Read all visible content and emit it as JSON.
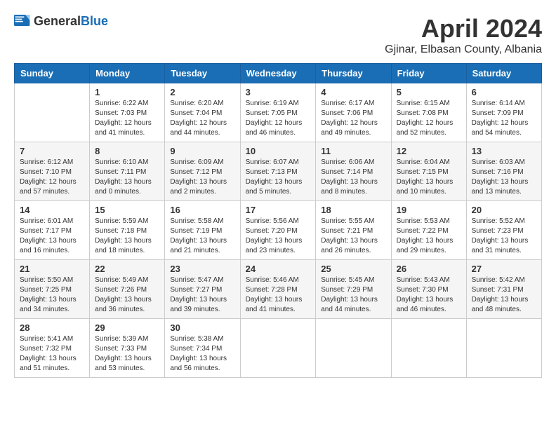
{
  "header": {
    "logo_general": "General",
    "logo_blue": "Blue",
    "month": "April 2024",
    "location": "Gjinar, Elbasan County, Albania"
  },
  "weekdays": [
    "Sunday",
    "Monday",
    "Tuesday",
    "Wednesday",
    "Thursday",
    "Friday",
    "Saturday"
  ],
  "weeks": [
    [
      {
        "day": "",
        "info": ""
      },
      {
        "day": "1",
        "info": "Sunrise: 6:22 AM\nSunset: 7:03 PM\nDaylight: 12 hours\nand 41 minutes."
      },
      {
        "day": "2",
        "info": "Sunrise: 6:20 AM\nSunset: 7:04 PM\nDaylight: 12 hours\nand 44 minutes."
      },
      {
        "day": "3",
        "info": "Sunrise: 6:19 AM\nSunset: 7:05 PM\nDaylight: 12 hours\nand 46 minutes."
      },
      {
        "day": "4",
        "info": "Sunrise: 6:17 AM\nSunset: 7:06 PM\nDaylight: 12 hours\nand 49 minutes."
      },
      {
        "day": "5",
        "info": "Sunrise: 6:15 AM\nSunset: 7:08 PM\nDaylight: 12 hours\nand 52 minutes."
      },
      {
        "day": "6",
        "info": "Sunrise: 6:14 AM\nSunset: 7:09 PM\nDaylight: 12 hours\nand 54 minutes."
      }
    ],
    [
      {
        "day": "7",
        "info": "Sunrise: 6:12 AM\nSunset: 7:10 PM\nDaylight: 12 hours\nand 57 minutes."
      },
      {
        "day": "8",
        "info": "Sunrise: 6:10 AM\nSunset: 7:11 PM\nDaylight: 13 hours\nand 0 minutes."
      },
      {
        "day": "9",
        "info": "Sunrise: 6:09 AM\nSunset: 7:12 PM\nDaylight: 13 hours\nand 2 minutes."
      },
      {
        "day": "10",
        "info": "Sunrise: 6:07 AM\nSunset: 7:13 PM\nDaylight: 13 hours\nand 5 minutes."
      },
      {
        "day": "11",
        "info": "Sunrise: 6:06 AM\nSunset: 7:14 PM\nDaylight: 13 hours\nand 8 minutes."
      },
      {
        "day": "12",
        "info": "Sunrise: 6:04 AM\nSunset: 7:15 PM\nDaylight: 13 hours\nand 10 minutes."
      },
      {
        "day": "13",
        "info": "Sunrise: 6:03 AM\nSunset: 7:16 PM\nDaylight: 13 hours\nand 13 minutes."
      }
    ],
    [
      {
        "day": "14",
        "info": "Sunrise: 6:01 AM\nSunset: 7:17 PM\nDaylight: 13 hours\nand 16 minutes."
      },
      {
        "day": "15",
        "info": "Sunrise: 5:59 AM\nSunset: 7:18 PM\nDaylight: 13 hours\nand 18 minutes."
      },
      {
        "day": "16",
        "info": "Sunrise: 5:58 AM\nSunset: 7:19 PM\nDaylight: 13 hours\nand 21 minutes."
      },
      {
        "day": "17",
        "info": "Sunrise: 5:56 AM\nSunset: 7:20 PM\nDaylight: 13 hours\nand 23 minutes."
      },
      {
        "day": "18",
        "info": "Sunrise: 5:55 AM\nSunset: 7:21 PM\nDaylight: 13 hours\nand 26 minutes."
      },
      {
        "day": "19",
        "info": "Sunrise: 5:53 AM\nSunset: 7:22 PM\nDaylight: 13 hours\nand 29 minutes."
      },
      {
        "day": "20",
        "info": "Sunrise: 5:52 AM\nSunset: 7:23 PM\nDaylight: 13 hours\nand 31 minutes."
      }
    ],
    [
      {
        "day": "21",
        "info": "Sunrise: 5:50 AM\nSunset: 7:25 PM\nDaylight: 13 hours\nand 34 minutes."
      },
      {
        "day": "22",
        "info": "Sunrise: 5:49 AM\nSunset: 7:26 PM\nDaylight: 13 hours\nand 36 minutes."
      },
      {
        "day": "23",
        "info": "Sunrise: 5:47 AM\nSunset: 7:27 PM\nDaylight: 13 hours\nand 39 minutes."
      },
      {
        "day": "24",
        "info": "Sunrise: 5:46 AM\nSunset: 7:28 PM\nDaylight: 13 hours\nand 41 minutes."
      },
      {
        "day": "25",
        "info": "Sunrise: 5:45 AM\nSunset: 7:29 PM\nDaylight: 13 hours\nand 44 minutes."
      },
      {
        "day": "26",
        "info": "Sunrise: 5:43 AM\nSunset: 7:30 PM\nDaylight: 13 hours\nand 46 minutes."
      },
      {
        "day": "27",
        "info": "Sunrise: 5:42 AM\nSunset: 7:31 PM\nDaylight: 13 hours\nand 48 minutes."
      }
    ],
    [
      {
        "day": "28",
        "info": "Sunrise: 5:41 AM\nSunset: 7:32 PM\nDaylight: 13 hours\nand 51 minutes."
      },
      {
        "day": "29",
        "info": "Sunrise: 5:39 AM\nSunset: 7:33 PM\nDaylight: 13 hours\nand 53 minutes."
      },
      {
        "day": "30",
        "info": "Sunrise: 5:38 AM\nSunset: 7:34 PM\nDaylight: 13 hours\nand 56 minutes."
      },
      {
        "day": "",
        "info": ""
      },
      {
        "day": "",
        "info": ""
      },
      {
        "day": "",
        "info": ""
      },
      {
        "day": "",
        "info": ""
      }
    ]
  ]
}
